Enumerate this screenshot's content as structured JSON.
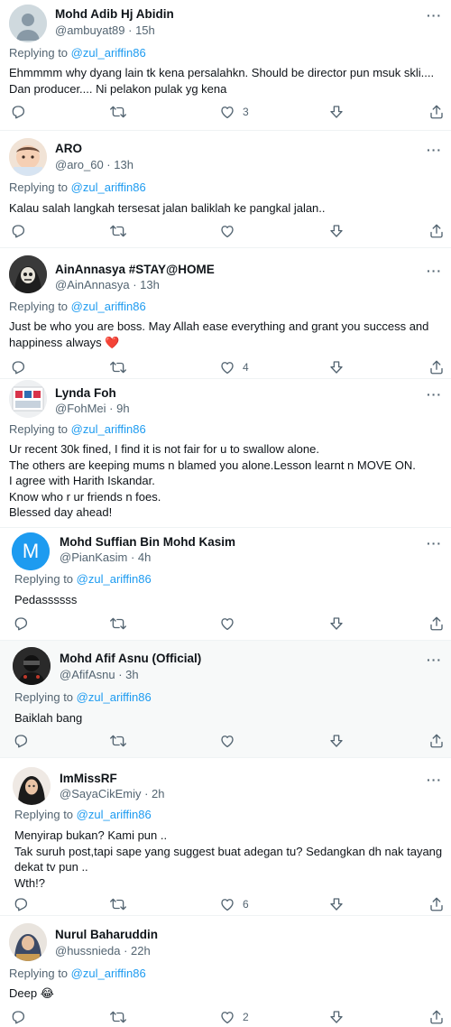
{
  "replying_prefix": "Replying to",
  "tweets": [
    {
      "name": "Mohd Adib Hj Abidin",
      "handle": "@ambuyat89 · 15h",
      "replying_to": "@zul_ariffin86",
      "lines": [
        "Ehmmmm why dyang lain tk kena persalahkn. Should be director pun msuk skli....",
        "Dan producer.... Ni pelakon pulak yg kena"
      ],
      "likes": "3",
      "avatar": "default-grey"
    },
    {
      "name": "ARO",
      "handle": "@aro_60 · 13h",
      "replying_to": "@zul_ariffin86",
      "lines": [
        "Kalau salah langkah tersesat jalan baliklah ke pangkal jalan.."
      ],
      "likes": "",
      "avatar": "baby-photo"
    },
    {
      "name": "AinAnnasya #STAY@HOME",
      "handle": "@AinAnnasya · 13h",
      "replying_to": "@zul_ariffin86",
      "lines": [
        "Just be who you are boss. May Allah ease everything and grant you success and",
        "happiness always"
      ],
      "emoji": "❤️",
      "likes": "4",
      "avatar": "skull-mask"
    },
    {
      "name": "Lynda Foh",
      "handle": "@FohMei · 9h",
      "replying_to": "@zul_ariffin86",
      "lines": [
        "Ur recent 30k fined, I find it is not fair for u to swallow alone.",
        "The others are keeping mums n blamed you alone.Lesson learnt n MOVE ON.",
        "I agree with Harith  Iskandar.",
        "Know who r ur friends n foes.",
        "Blessed day ahead!"
      ],
      "likes": "",
      "avatar": "store-photo"
    },
    {
      "name": "Mohd Suffian Bin Mohd Kasim",
      "handle": "@PianKasim · 4h",
      "replying_to": "@zul_ariffin86",
      "lines": [
        "Pedassssss"
      ],
      "likes": "",
      "avatar": "letter-M",
      "avatar_letter": "M"
    },
    {
      "name": "Mohd Afif Asnu (Official)",
      "handle": "@AfifAsnu · 3h",
      "replying_to": "@zul_ariffin86",
      "lines": [
        "Baiklah bang"
      ],
      "likes": "",
      "avatar": "dark-photo"
    },
    {
      "name": "ImMissRF",
      "handle": "@SayaCikEmiy · 2h",
      "replying_to": "@zul_ariffin86",
      "lines": [
        "Menyirap bukan? Kami pun ..",
        "Tak suruh post,tapi sape yang suggest buat adegan tu? Sedangkan dh nak tayang",
        "dekat tv pun ..",
        "Wth!?"
      ],
      "likes": "6",
      "avatar": "hijab-photo"
    },
    {
      "name": "Nurul Baharuddin",
      "handle": "@hussnieda · 22h",
      "replying_to": "@zul_ariffin86",
      "lines": [
        "Deep"
      ],
      "emoji": "😂",
      "likes": "2",
      "avatar": "hijab-photo-2"
    }
  ],
  "colors": {
    "accent": "#1d9bf0",
    "muted": "#536471",
    "text": "#0f1419",
    "shaded": "#f7f9f9"
  },
  "icons": [
    "more-icon",
    "reply-icon",
    "retweet-icon",
    "like-icon",
    "download-icon",
    "share-icon"
  ]
}
